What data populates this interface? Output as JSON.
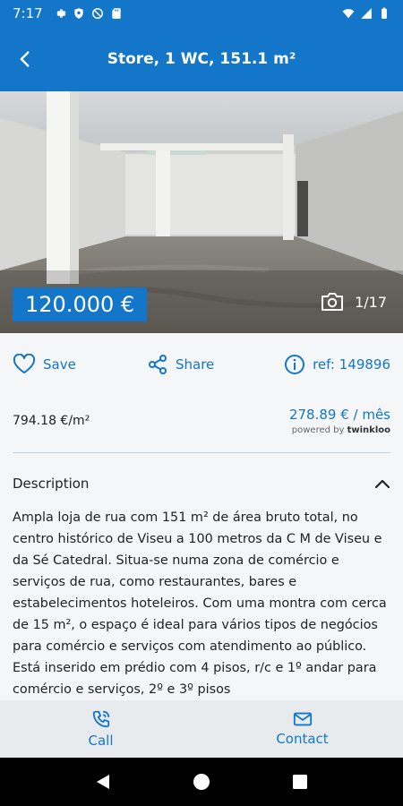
{
  "status_bar": {
    "time": "7:17"
  },
  "app_bar": {
    "title": "Store, 1 WC, 151.1 m²"
  },
  "listing": {
    "price": "120.000 €",
    "photo_counter": "1/17"
  },
  "actions": {
    "save_label": "Save",
    "share_label": "Share",
    "ref_label": "ref: 149896"
  },
  "pricing": {
    "price_per_m2": "794.18 €/m²",
    "monthly": "278.89 € / mês",
    "powered_by_prefix": "powered by",
    "powered_by_brand": "twinkloo"
  },
  "description": {
    "title": "Description",
    "text": "Ampla loja de rua com 151 m² de área bruto total, no centro histórico de Viseu a 100 metros da C M de Viseu e da Sé Catedral. Situa-se numa zona de comércio e serviços de rua, como restaurantes, bares e estabelecimentos hoteleiros. Com uma montra com cerca de 15 m², o espaço é ideal para vários tipos de negócios para comércio e serviços com atendimento ao público. Está inserido em prédio com 4 pisos, r/c e 1º andar para comércio e serviços, 2º e 3º pisos"
  },
  "bottom_bar": {
    "call_label": "Call",
    "contact_label": "Contact"
  },
  "colors": {
    "primary": "#1376c8",
    "bottom_bar": "#e7ebee",
    "background": "#f4f6f8"
  }
}
